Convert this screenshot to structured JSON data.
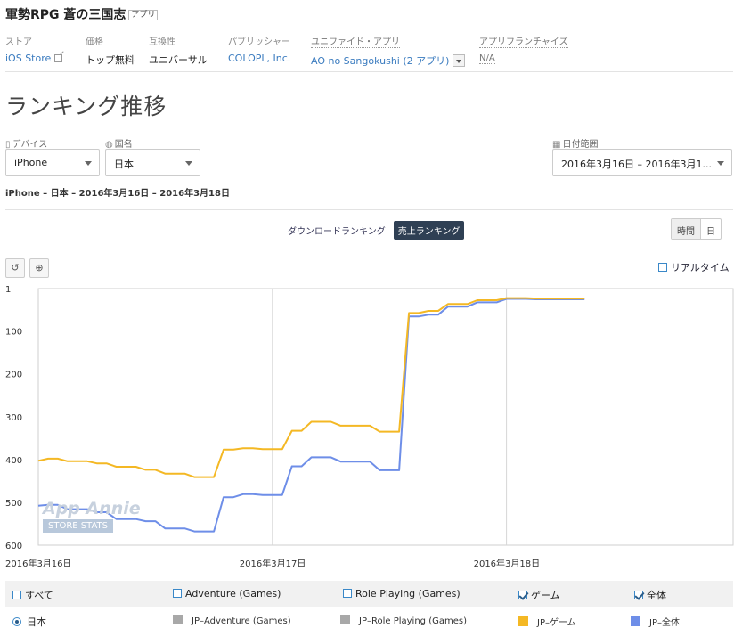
{
  "app": {
    "name": "軍勢RPG 蒼の三国志",
    "badge": "アプリ"
  },
  "meta": {
    "store": {
      "label": "ストア",
      "value": "iOS Store"
    },
    "price": {
      "label": "価格",
      "value": "トップ無料"
    },
    "compat": {
      "label": "互換性",
      "value": "ユニバーサル"
    },
    "publisher": {
      "label": "パブリッシャー",
      "value": "COLOPL, Inc."
    },
    "unified": {
      "label": "ユニファイド・アプリ",
      "value": "AO no Sangokushi (2 アプリ)"
    },
    "franchise": {
      "label": "アプリフランチャイズ",
      "value": "N/A"
    }
  },
  "page_title": "ランキング推移",
  "filters": {
    "device": {
      "label": "デバイス",
      "value": "iPhone"
    },
    "country": {
      "label": "国名",
      "value": "日本"
    },
    "date": {
      "label": "日付範囲",
      "value": "2016年3月16日 – 2016年3月1..."
    }
  },
  "summary": "iPhone – 日本 – 2016年3月16日 – 2016年3月18日",
  "tabs": {
    "download": "ダウンロードランキング",
    "revenue": "売上ランキング"
  },
  "granularity": {
    "hour": "時間",
    "day": "日"
  },
  "realtime_label": "リアルタイム",
  "watermark": {
    "name": "App Annie",
    "sub": "STORE STATS"
  },
  "legend_rows": {
    "categories": [
      {
        "label": "すべて",
        "checked": false
      },
      {
        "label": "Adventure (Games)",
        "checked": false
      },
      {
        "label": "Role Playing (Games)",
        "checked": false
      },
      {
        "label": "ゲーム",
        "checked": true
      },
      {
        "label": "全体",
        "checked": true
      }
    ],
    "country_label": "日本",
    "series_labels": [
      {
        "label": "JP–Adventure (Games)",
        "color": "#a8a8a8"
      },
      {
        "label": "JP–Role Playing (Games)",
        "color": "#a8a8a8"
      },
      {
        "label": "JP–ゲーム",
        "color": "#f4b824"
      },
      {
        "label": "JP–全体",
        "color": "#6e8ee8"
      }
    ]
  },
  "chart_data": {
    "type": "line",
    "y_reversed": true,
    "ylim": [
      1,
      600
    ],
    "yticks": [
      1,
      100,
      200,
      300,
      400,
      500,
      600
    ],
    "x_range_hours": [
      0,
      60
    ],
    "xticks": [
      {
        "hour": 0,
        "label": "2016年3月16日"
      },
      {
        "hour": 24,
        "label": "2016年3月17日"
      },
      {
        "hour": 48,
        "label": "2016年3月18日"
      }
    ],
    "grid": "vertical-day-lines",
    "series": [
      {
        "name": "JP–ゲーム",
        "color": "#f4b824",
        "points": [
          [
            0,
            403
          ],
          [
            1,
            398
          ],
          [
            2,
            398
          ],
          [
            3,
            404
          ],
          [
            4,
            404
          ],
          [
            5,
            404
          ],
          [
            6,
            409
          ],
          [
            7,
            409
          ],
          [
            8,
            417
          ],
          [
            9,
            417
          ],
          [
            10,
            417
          ],
          [
            11,
            424
          ],
          [
            12,
            424
          ],
          [
            13,
            433
          ],
          [
            14,
            433
          ],
          [
            15,
            433
          ],
          [
            16,
            441
          ],
          [
            17,
            441
          ],
          [
            18,
            441
          ],
          [
            19,
            377
          ],
          [
            20,
            377
          ],
          [
            21,
            374
          ],
          [
            22,
            374
          ],
          [
            23,
            376
          ],
          [
            24,
            376
          ],
          [
            25,
            376
          ],
          [
            26,
            333
          ],
          [
            27,
            333
          ],
          [
            28,
            312
          ],
          [
            29,
            312
          ],
          [
            30,
            312
          ],
          [
            31,
            321
          ],
          [
            32,
            321
          ],
          [
            33,
            321
          ],
          [
            34,
            321
          ],
          [
            35,
            335
          ],
          [
            36,
            335
          ],
          [
            37,
            335
          ],
          [
            38,
            58
          ],
          [
            39,
            58
          ],
          [
            40,
            53
          ],
          [
            41,
            53
          ],
          [
            42,
            37
          ],
          [
            43,
            37
          ],
          [
            44,
            37
          ],
          [
            45,
            28
          ],
          [
            46,
            28
          ],
          [
            47,
            28
          ],
          [
            48,
            23
          ],
          [
            49,
            23
          ],
          [
            50,
            23
          ],
          [
            51,
            24
          ],
          [
            52,
            24
          ],
          [
            53,
            24
          ],
          [
            54,
            24
          ],
          [
            55,
            24
          ],
          [
            56,
            24
          ]
        ]
      },
      {
        "name": "JP–全体",
        "color": "#6e8ee8",
        "points": [
          [
            0,
            508
          ],
          [
            1,
            506
          ],
          [
            2,
            506
          ],
          [
            3,
            516
          ],
          [
            4,
            516
          ],
          [
            5,
            516
          ],
          [
            6,
            523
          ],
          [
            7,
            523
          ],
          [
            8,
            539
          ],
          [
            9,
            539
          ],
          [
            10,
            539
          ],
          [
            11,
            544
          ],
          [
            12,
            544
          ],
          [
            13,
            561
          ],
          [
            14,
            561
          ],
          [
            15,
            561
          ],
          [
            16,
            568
          ],
          [
            17,
            568
          ],
          [
            18,
            568
          ],
          [
            19,
            488
          ],
          [
            20,
            488
          ],
          [
            21,
            481
          ],
          [
            22,
            481
          ],
          [
            23,
            483
          ],
          [
            24,
            483
          ],
          [
            25,
            483
          ],
          [
            26,
            416
          ],
          [
            27,
            416
          ],
          [
            28,
            395
          ],
          [
            29,
            395
          ],
          [
            30,
            395
          ],
          [
            31,
            405
          ],
          [
            32,
            405
          ],
          [
            33,
            405
          ],
          [
            34,
            405
          ],
          [
            35,
            425
          ],
          [
            36,
            425
          ],
          [
            37,
            425
          ],
          [
            38,
            66
          ],
          [
            39,
            66
          ],
          [
            40,
            62
          ],
          [
            41,
            62
          ],
          [
            42,
            43
          ],
          [
            43,
            43
          ],
          [
            44,
            43
          ],
          [
            45,
            33
          ],
          [
            46,
            33
          ],
          [
            47,
            33
          ],
          [
            48,
            25
          ],
          [
            49,
            25
          ],
          [
            50,
            25
          ],
          [
            51,
            26
          ],
          [
            52,
            26
          ],
          [
            53,
            26
          ],
          [
            54,
            26
          ],
          [
            55,
            26
          ],
          [
            56,
            26
          ]
        ]
      }
    ]
  }
}
